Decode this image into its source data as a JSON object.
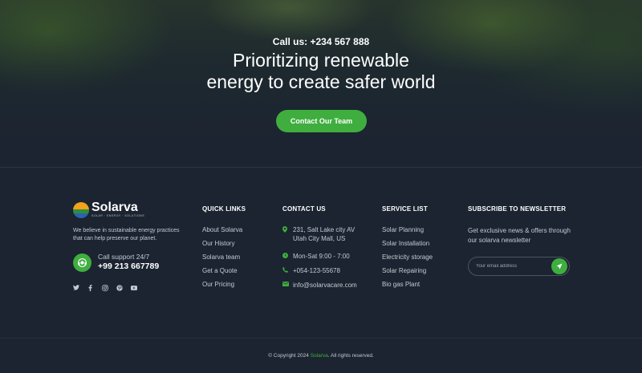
{
  "hero": {
    "call_us": "Call us: +234 567 888",
    "headline_line1": "Prioritizing renewable",
    "headline_line2": "energy to create safer world",
    "cta_label": "Contact Our Team"
  },
  "brand": {
    "name": "Solarva",
    "tagline": "SOLAR · ENERGY · SOLUTIONS",
    "about": "We believe in sustainable energy practices that can help preserve our planet.",
    "support_label": "Call support 24/7",
    "support_phone": "+99 213 667789",
    "socials": [
      "twitter-icon",
      "facebook-icon",
      "instagram-icon",
      "pinterest-icon",
      "youtube-icon"
    ]
  },
  "quick_links": {
    "title": "QUICK LINKS",
    "items": [
      "About Solarva",
      "Our History",
      "Solarva team",
      "Get a Quote",
      "Our Pricing"
    ]
  },
  "contact": {
    "title": "CONTACT US",
    "address_line1": "231, Salt Lake city AV",
    "address_line2": "Utah City Mall, US",
    "hours": "Mon-Sat 9:00 - 7:00",
    "phone": "+054-123-55678",
    "email": "info@solarvacare.com"
  },
  "services": {
    "title": "SERVICE LIST",
    "items": [
      "Solar Planning",
      "Solar Installation",
      "Electricity storage",
      "Solar Repairing",
      "Bio gas Plant"
    ]
  },
  "newsletter": {
    "title": "SUBSCRIBE TO NEWSLETTER",
    "text": "Get exclusive news & offers through our solarva newsletter",
    "placeholder": "Your email address"
  },
  "footer": {
    "copyright_prefix": "© Copyright 2024",
    "copyright_brand": "Solarva",
    "copyright_suffix": ". All rights reserved."
  },
  "colors": {
    "accent": "#3fae3f",
    "background": "#1b2430",
    "text_muted": "#c3cbd3"
  }
}
